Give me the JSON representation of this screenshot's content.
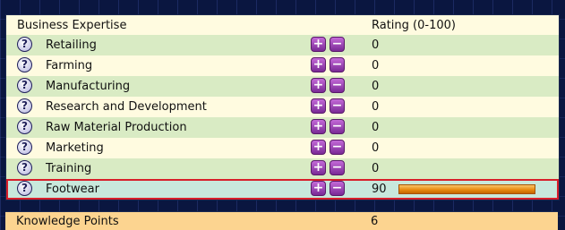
{
  "header": {
    "expertise_label": "Business Expertise",
    "rating_label": "Rating (0-100)"
  },
  "rows": [
    {
      "label": "Retailing",
      "value": "0"
    },
    {
      "label": "Farming",
      "value": "0"
    },
    {
      "label": "Manufacturing",
      "value": "0"
    },
    {
      "label": "Research and Development",
      "value": "0"
    },
    {
      "label": "Raw Material Production",
      "value": "0"
    },
    {
      "label": "Marketing",
      "value": "0"
    },
    {
      "label": "Training",
      "value": "0"
    },
    {
      "label": "Footwear",
      "value": "90",
      "rating_fraction": 0.9,
      "selected": true
    }
  ],
  "icons": {
    "help": "?",
    "plus": "+",
    "minus": "−"
  },
  "footer": {
    "label": "Knowledge Points",
    "value": "6"
  },
  "colors": {
    "selected_outline": "#d81e2a",
    "bar": "#e88a10",
    "button": "#9a3ab6"
  }
}
